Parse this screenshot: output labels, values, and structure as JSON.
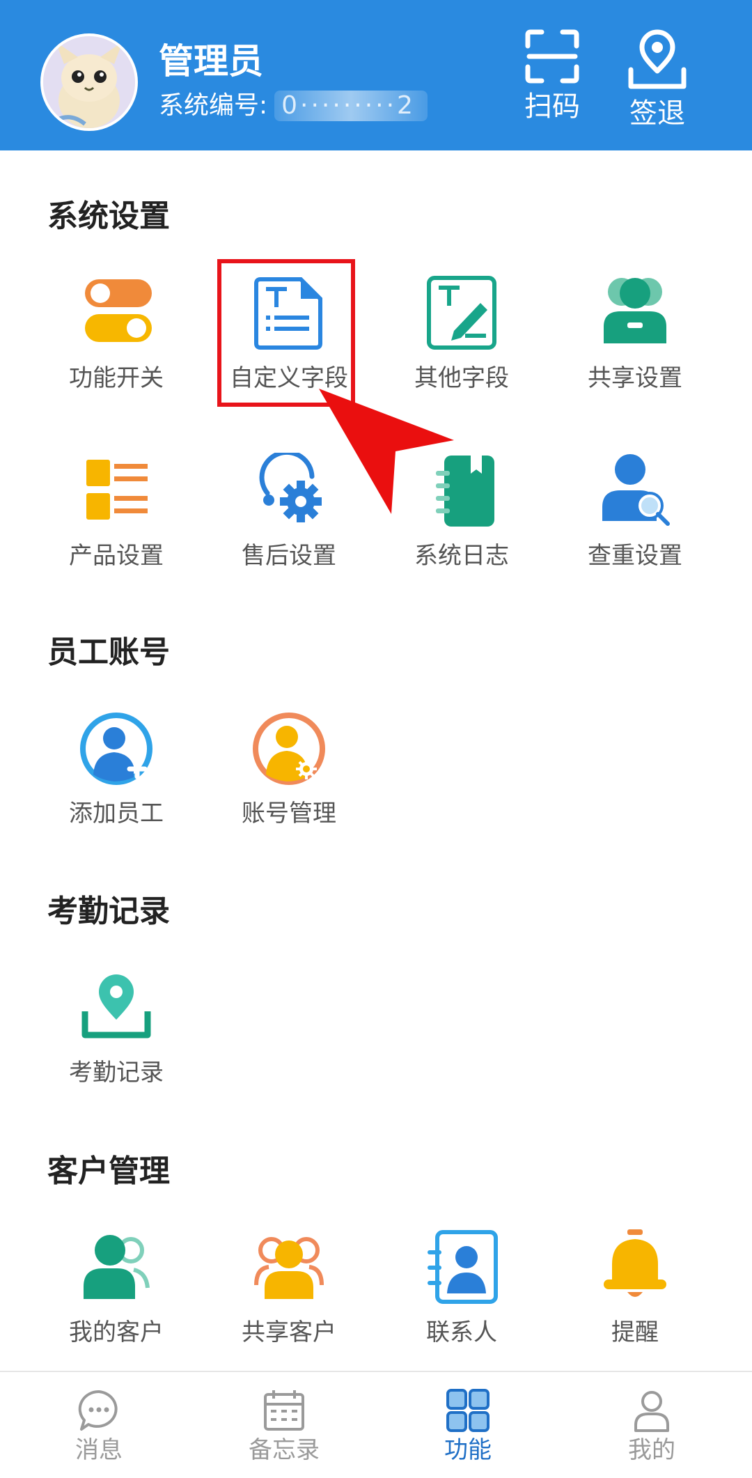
{
  "header": {
    "name": "管理员",
    "id_label": "系统编号:",
    "id_value": "0·········2",
    "scan_label": "扫码",
    "checkout_label": "签退"
  },
  "sections": {
    "system": {
      "title": "系统设置",
      "items": [
        {
          "label": "功能开关",
          "icon": "toggle-switch-icon"
        },
        {
          "label": "自定义字段",
          "icon": "custom-field-document-icon"
        },
        {
          "label": "其他字段",
          "icon": "text-edit-icon"
        },
        {
          "label": "共享设置",
          "icon": "shared-users-icon"
        },
        {
          "label": "产品设置",
          "icon": "product-list-icon"
        },
        {
          "label": "售后设置",
          "icon": "after-sales-gear-icon"
        },
        {
          "label": "系统日志",
          "icon": "notebook-icon"
        },
        {
          "label": "查重设置",
          "icon": "user-search-icon"
        }
      ]
    },
    "staff": {
      "title": "员工账号",
      "items": [
        {
          "label": "添加员工",
          "icon": "add-user-icon"
        },
        {
          "label": "账号管理",
          "icon": "user-settings-icon"
        }
      ]
    },
    "attendance": {
      "title": "考勤记录",
      "items": [
        {
          "label": "考勤记录",
          "icon": "location-pin-icon"
        }
      ]
    },
    "customers": {
      "title": "客户管理",
      "items": [
        {
          "label": "我的客户",
          "icon": "my-customers-icon"
        },
        {
          "label": "共享客户",
          "icon": "shared-customers-icon"
        },
        {
          "label": "联系人",
          "icon": "contact-card-icon"
        },
        {
          "label": "提醒",
          "icon": "bell-icon"
        }
      ]
    }
  },
  "tabbar": {
    "items": [
      {
        "label": "消息",
        "icon": "chat-bubble-icon",
        "active": false
      },
      {
        "label": "备忘录",
        "icon": "calendar-icon",
        "active": false
      },
      {
        "label": "功能",
        "icon": "grid-icon",
        "active": true
      },
      {
        "label": "我的",
        "icon": "person-icon",
        "active": false
      }
    ]
  },
  "colors": {
    "header_bg": "#2a8ae0",
    "highlight": "#e8141a",
    "tab_active": "#1f6fc6",
    "tab_inactive": "#9a9a9a"
  }
}
